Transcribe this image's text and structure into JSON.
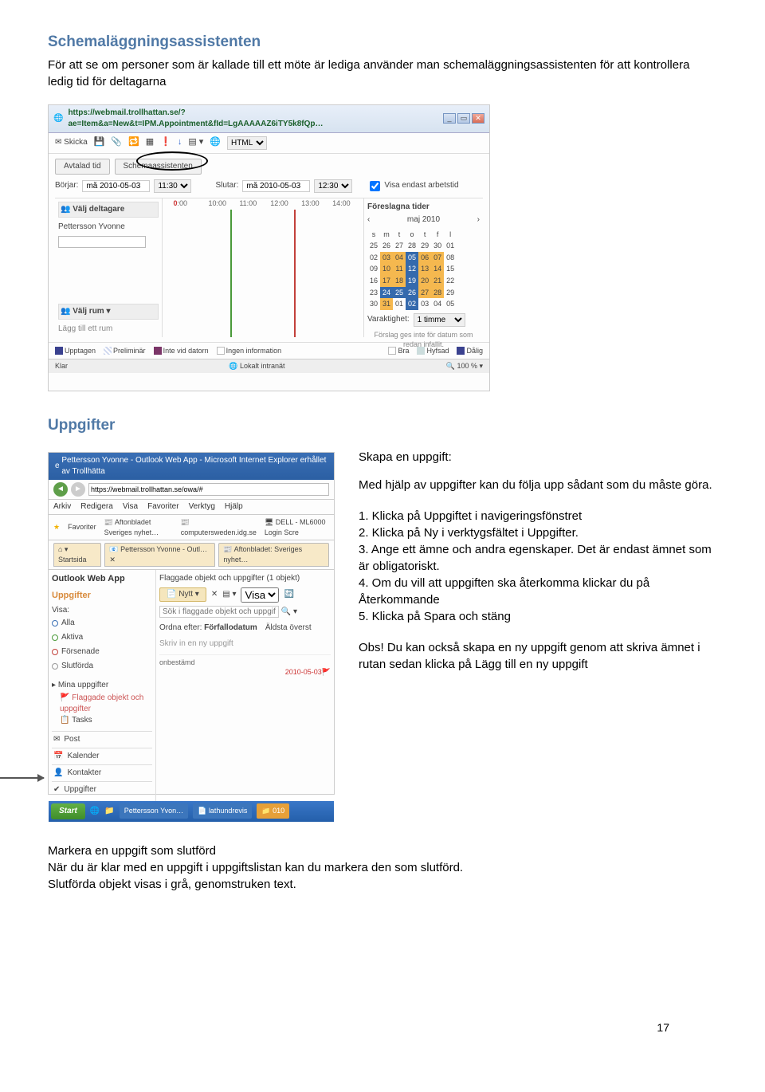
{
  "heading1": "Schemaläggningsassistenten",
  "intro1": "För att se om personer som är kallade till ett möte är lediga använder man schemaläggningsassistenten för att kontrollera ledig tid för deltagarna",
  "ss1": {
    "url": "https://webmail.trollhattan.se/?ae=Item&a=New&t=IPM.Appointment&fId=LgAAAAAZ6iTY5k8fQp…",
    "skicka_label": "Skicka",
    "html_dropdown": "HTML",
    "tab_avtalad": "Avtalad tid",
    "tab_schema": "Schemaassistenten",
    "start_label": "Börjar:",
    "start_date": "må 2010-05-03",
    "start_time": "11:30",
    "end_label": "Slutar:",
    "end_date": "må 2010-05-03",
    "end_time": "12:30",
    "worktime_label": "Visa endast arbetstid",
    "valj_deltagare": "Välj deltagare",
    "attendee1": "Pettersson Yvonne",
    "time_headers": [
      ":00",
      "10:00",
      "11:00",
      "12:00",
      "13:00",
      "14:00"
    ],
    "valj_rum": "Välj rum",
    "lagg_rum": "Lägg till ett rum",
    "foreslagna": "Föreslagna tider",
    "cal_month": "maj 2010",
    "cal_days": [
      "s",
      "m",
      "t",
      "o",
      "t",
      "f",
      "l"
    ],
    "cal_rows": [
      [
        "25",
        "26",
        "27",
        "28",
        "29",
        "30",
        "01"
      ],
      [
        "02",
        "03",
        "04",
        "05",
        "06",
        "07",
        "08"
      ],
      [
        "09",
        "10",
        "11",
        "12",
        "13",
        "14",
        "15"
      ],
      [
        "16",
        "17",
        "18",
        "19",
        "20",
        "21",
        "22"
      ],
      [
        "23",
        "24",
        "25",
        "26",
        "27",
        "28",
        "29"
      ],
      [
        "30",
        "31",
        "01",
        "02",
        "03",
        "04",
        "05"
      ]
    ],
    "varaktighet_lbl": "Varaktighet:",
    "varaktighet_val": "1 timme",
    "forslag_note1": "Förslag ges inte för datum som",
    "forslag_note2": "redan infallit.",
    "legend_upptagen": "Upptagen",
    "legend_prelim": "Preliminär",
    "legend_intevid": "Inte vid datorn",
    "legend_ingen": "Ingen information",
    "legend_bra": "Bra",
    "legend_hyfsad": "Hyfsad",
    "legend_dalig": "Dålig",
    "status_left": "Klar",
    "status_mid": "Lokalt intranät",
    "status_right": "100 %"
  },
  "heading2": "Uppgifter",
  "ss2": {
    "title": "Pettersson Yvonne - Outlook Web App - Microsoft Internet Explorer erhållet av Trollhätta",
    "url": "https://webmail.trollhattan.se/owa/#",
    "menu": [
      "Arkiv",
      "Redigera",
      "Visa",
      "Favoriter",
      "Verktyg",
      "Hjälp"
    ],
    "fav_lbl": "Favoriter",
    "fav_items": [
      "Aftonbladet Sveriges nyhet…",
      "computersweden.idg.se",
      "DELL - ML6000 Login Scre"
    ],
    "tab_start": "Startsida",
    "tab_pet": "Pettersson Yvonne - Outl…",
    "tab_aft": "Aftonbladet: Sveriges nyhet…",
    "owa_brand": "Outlook Web App",
    "owa_heading": "Uppgifter",
    "visa_lbl": "Visa:",
    "filter_alla": "Alla",
    "filter_aktiva": "Aktiva",
    "filter_forsenade": "Försenade",
    "filter_slutforda": "Slutförda",
    "mina_uppgifter": "Mina uppgifter",
    "flaggade": "Flaggade objekt och uppgifter",
    "tasks": "Tasks",
    "nav_post": "Post",
    "nav_kalender": "Kalender",
    "nav_kontakter": "Kontakter",
    "nav_uppgifter": "Uppgifter",
    "right_head": "Flaggade objekt och uppgifter  (1 objekt)",
    "btn_nytt": "Nytt",
    "visa_dd": "Visa",
    "sok_placeholder": "Sök i flaggade objekt och uppgifter",
    "ordna_lbl": "Ordna efter:",
    "ordna_val": "Förfallodatum",
    "ordna_dir": "Äldsta överst",
    "task_hint": "Skriv in en ny uppgift",
    "grp_hdr": "onbestämd",
    "task_date": "2010-05-03",
    "start_btn": "Start",
    "taskbar1": "Pettersson Yvon…",
    "taskbar2": "lathundrevis",
    "taskbar3": "010"
  },
  "instr": {
    "title": "Skapa en uppgift:",
    "lead": "Med hjälp av uppgifter kan du följa upp sådant som du måste göra.",
    "s1": "1. Klicka på Uppgiftet i navigeringsfönstret",
    "s2": "2. Klicka på Ny i verktygsfältet i Uppgifter.",
    "s3": "3. Ange ett ämne och andra egenskaper. Det är endast ämnet som är obligatoriskt.",
    "s4": "4. Om du vill att uppgiften ska återkomma klickar du på Återkommande",
    "s5": "5. Klicka på Spara och stäng",
    "obs": "Obs! Du kan också skapa en ny uppgift genom att skriva ämnet i rutan             sedan klicka på Lägg till en ny uppgift"
  },
  "closing": {
    "h": "Markera en uppgift som slutförd",
    "p1": "När du är klar med en uppgift i uppgiftslistan kan du markera den som slutförd.",
    "p2": "Slutförda objekt visas i grå, genomstruken text."
  },
  "page_number": "17"
}
